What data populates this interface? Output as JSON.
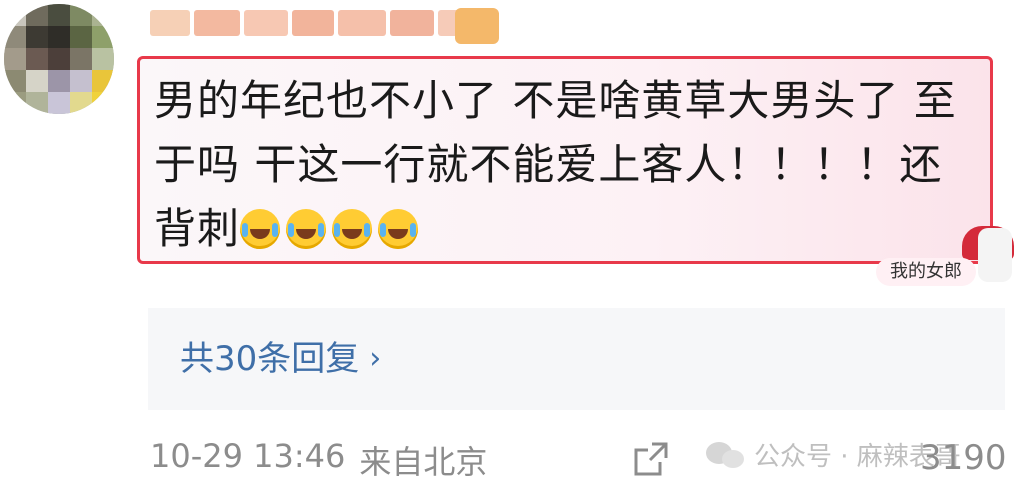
{
  "comment": {
    "username": "",
    "text_line1": "男的年纪也不小了 不是啥黄草大男头了 至",
    "text_line2": "于吗 干这一行就不能爱上客人！！！！还",
    "text_line3": "背刺",
    "emojis": [
      "laugh-cry-emoji",
      "laugh-cry-emoji",
      "laugh-cry-emoji",
      "laugh-cry-emoji"
    ]
  },
  "sticker": {
    "label": "我的女郎"
  },
  "replies": {
    "label": "共30条回复"
  },
  "footer": {
    "time": "10-29 13:46",
    "location": "来自北京",
    "likes": "3190"
  },
  "watermark": {
    "text": "公众号 · 麻辣表哥"
  },
  "colors": {
    "highlight_border": "#e8394a",
    "link": "#3f6fa8",
    "meta": "#8c8c8c"
  }
}
